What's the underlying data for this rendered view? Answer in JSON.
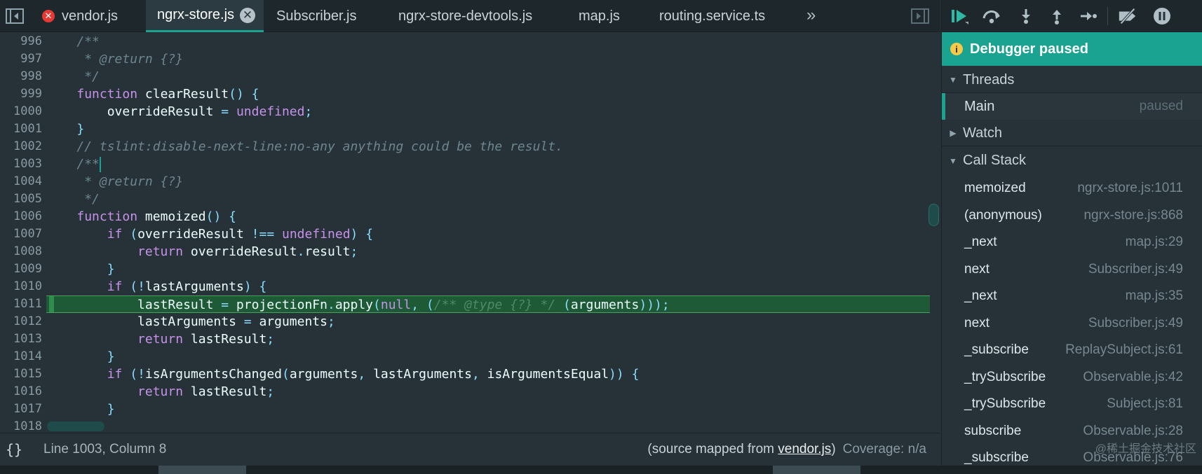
{
  "tabs": [
    {
      "label": "vendor.js",
      "has_error": true,
      "active": false
    },
    {
      "label": "ngrx-store.js",
      "active": true,
      "closable": true
    },
    {
      "label": "Subscriber.js",
      "active": false
    },
    {
      "label": "ngrx-store-devtools.js",
      "active": false
    },
    {
      "label": "map.js",
      "active": false
    },
    {
      "label": "routing.service.ts",
      "active": false
    }
  ],
  "more_tabs_glyph": "»",
  "error_glyph": "✕",
  "close_glyph": "✕",
  "editor": {
    "line_numbers": [
      "996",
      "997",
      "998",
      "999",
      "1000",
      "1001",
      "1002",
      "1003",
      "1004",
      "1005",
      "1006",
      "1007",
      "1008",
      "1009",
      "1010",
      "1011",
      "1012",
      "1013",
      "1014",
      "1015",
      "1016",
      "1017",
      "1018"
    ],
    "execution_line": "1011",
    "cursor_line": "1003"
  },
  "status": {
    "pretty_print": "{}",
    "cursor_position": "Line 1003, Column 8",
    "source_mapped_prefix": "(source mapped from ",
    "source_mapped_file": "vendor.js",
    "source_mapped_suffix": ")",
    "coverage": "Coverage: n/a"
  },
  "debugger": {
    "banner": "Debugger paused",
    "banner_icon": "i",
    "threads_label": "Threads",
    "thread": {
      "name": "Main",
      "status": "paused"
    },
    "watch_label": "Watch",
    "call_stack_label": "Call Stack",
    "frames": [
      {
        "name": "memoized",
        "loc": "ngrx-store.js:1011"
      },
      {
        "name": "(anonymous)",
        "loc": "ngrx-store.js:868"
      },
      {
        "name": "_next",
        "loc": "map.js:29"
      },
      {
        "name": "next",
        "loc": "Subscriber.js:49"
      },
      {
        "name": "_next",
        "loc": "map.js:35"
      },
      {
        "name": "next",
        "loc": "Subscriber.js:49"
      },
      {
        "name": "_subscribe",
        "loc": "ReplaySubject.js:61"
      },
      {
        "name": "_trySubscribe",
        "loc": "Observable.js:42"
      },
      {
        "name": "_trySubscribe",
        "loc": "Subject.js:81"
      },
      {
        "name": "subscribe",
        "loc": "Observable.js:28"
      },
      {
        "name": "_subscribe",
        "loc": "Observable.js:76"
      }
    ]
  },
  "watermark": "@稀土掘金技术社区",
  "colors": {
    "accent": "#1ba391",
    "exec_line_bg": "#1e5a36",
    "error_red": "#e53935",
    "keyword": "#c792ea",
    "comment": "#6e8590"
  }
}
